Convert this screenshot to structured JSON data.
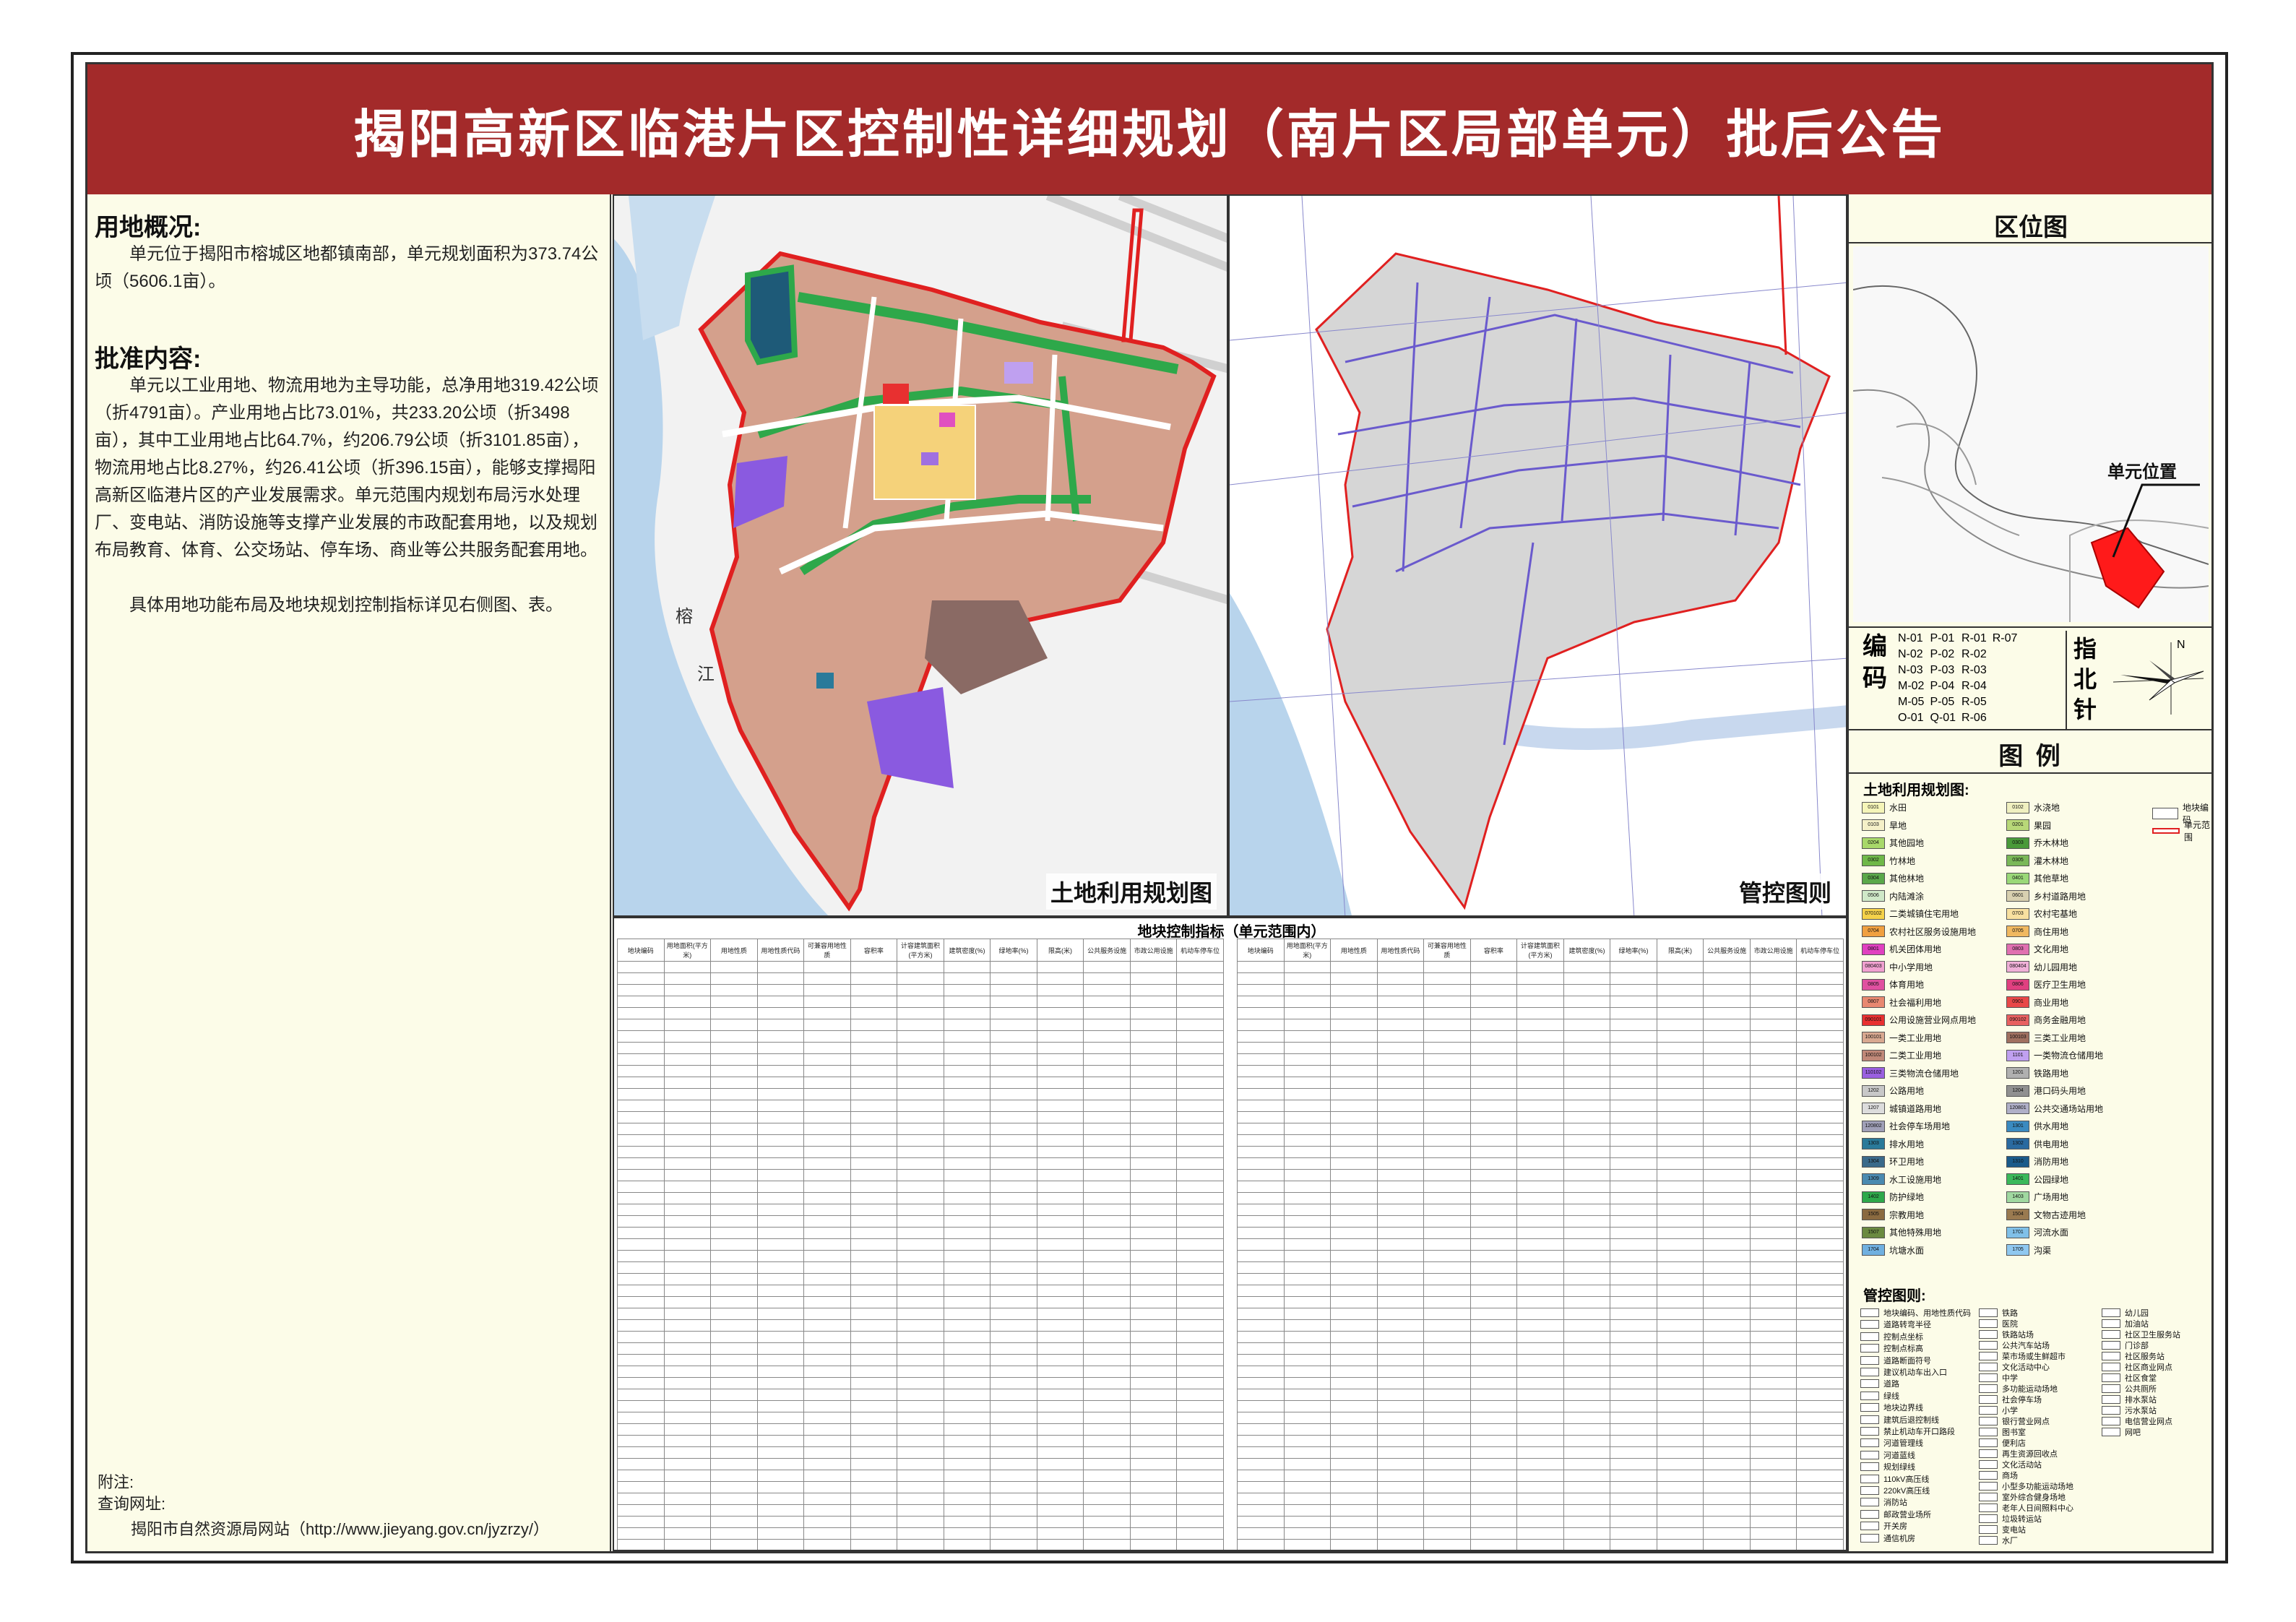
{
  "title": "揭阳高新区临港片区控制性详细规划（南片区局部单元）批后公告",
  "overview": {
    "heading": "用地概况:",
    "text": "单元位于揭阳市榕城区地都镇南部，单元规划面积为373.74公顷（5606.1亩）。"
  },
  "approval": {
    "heading": "批准内容:",
    "text1": "单元以工业用地、物流用地为主导功能，总净用地319.42公顷（折4791亩）。产业用地占比73.01%，共233.20公顷（折3498亩），其中工业用地占比64.7%，约206.79公顷（折3101.85亩），物流用地占比8.27%，约26.41公顷（折396.15亩），能够支撑揭阳高新区临港片区的产业发展需求。单元范围内规划布局污水处理厂、变电站、消防设施等支撑产业发展的市政配套用地，以及规划布局教育、体育、公交场站、停车场、商业等公共服务配套用地。",
    "text2": "具体用地功能布局及地块规划控制指标详见右侧图、表。"
  },
  "footer": {
    "note": "附注:",
    "query": "查询网址:",
    "site": "揭阳市自然资源局网站（http://www.jieyang.gov.cn/jyzrzy/）"
  },
  "map1": {
    "label": "土地利用规划图",
    "river_char1": "榕",
    "river_char2": "江"
  },
  "map2": {
    "label": "管控图则"
  },
  "table": {
    "title": "地块控制指标（单元范围内）",
    "headers": [
      "地块编码",
      "用地面积(平方米)",
      "用地性质",
      "用地性质代码",
      "可兼容用地性质",
      "容积率",
      "计容建筑面积(平方米)",
      "建筑密度(%)",
      "绿地率(%)",
      "限高(米)",
      "公共服务设施",
      "市政公用设施",
      "机动车停车位"
    ]
  },
  "location": {
    "title": "区位图",
    "marker": "单元位置"
  },
  "codes": {
    "label": "编码",
    "col1": [
      "N-01",
      "N-02",
      "N-03",
      "M-02",
      "M-05",
      "O-01"
    ],
    "col2": [
      "P-01",
      "P-02",
      "P-03",
      "P-04",
      "P-05",
      "Q-01"
    ],
    "col3": [
      "R-01",
      "R-02",
      "R-03",
      "R-04",
      "R-05",
      "R-06"
    ],
    "col4": [
      "R-07"
    ],
    "compass_label": "指北针",
    "north": "N"
  },
  "legend": {
    "title": "图    例",
    "land_title": "土地利用规划图:",
    "land_left": [
      {
        "code": "0101",
        "name": "水田",
        "color": "#f5f5b8"
      },
      {
        "code": "0103",
        "name": "旱地",
        "color": "#f5f0c8"
      },
      {
        "code": "0204",
        "name": "其他园地",
        "color": "#a8d86a"
      },
      {
        "code": "0302",
        "name": "竹林地",
        "color": "#6fb848"
      },
      {
        "code": "0304",
        "name": "其他林地",
        "color": "#5aa84a"
      },
      {
        "code": "0506",
        "name": "内陆滩涂",
        "color": "#cfe8c8"
      },
      {
        "code": "070102",
        "name": "二类城镇住宅用地",
        "color": "#f5d24a"
      },
      {
        "code": "0704",
        "name": "农村社区服务设施用地",
        "color": "#f0a040"
      },
      {
        "code": "0801",
        "name": "机关团体用地",
        "color": "#e040c0"
      },
      {
        "code": "080403",
        "name": "中小学用地",
        "color": "#f0a0d0"
      },
      {
        "code": "0805",
        "name": "体育用地",
        "color": "#e050a0"
      },
      {
        "code": "0807",
        "name": "社会福利用地",
        "color": "#e88870"
      },
      {
        "code": "090101",
        "name": "公用设施营业网点用地",
        "color": "#e83030"
      },
      {
        "code": "100101",
        "name": "一类工业用地",
        "color": "#d8a890"
      },
      {
        "code": "100102",
        "name": "二类工业用地",
        "color": "#c08878"
      },
      {
        "code": "110102",
        "name": "三类物流仓储用地",
        "color": "#9a60e0"
      },
      {
        "code": "1202",
        "name": "公路用地",
        "color": "#c8c8c8"
      },
      {
        "code": "1207",
        "name": "城镇道路用地",
        "color": "#dcdcdc"
      },
      {
        "code": "120802",
        "name": "社会停车场用地",
        "color": "#a0a0b8"
      },
      {
        "code": "1303",
        "name": "排水用地",
        "color": "#2a7a9a"
      },
      {
        "code": "1304",
        "name": "环卫用地",
        "color": "#3a6a8a"
      },
      {
        "code": "1309",
        "name": "水工设施用地",
        "color": "#4a8ab0"
      },
      {
        "code": "1402",
        "name": "防护绿地",
        "color": "#2ea84a"
      },
      {
        "code": "1505",
        "name": "宗教用地",
        "color": "#8a6a40"
      },
      {
        "code": "1507",
        "name": "其他特殊用地",
        "color": "#6a8a40"
      },
      {
        "code": "1704",
        "name": "坑塘水面",
        "color": "#70b0e0"
      }
    ],
    "land_right": [
      {
        "code": "0102",
        "name": "水浇地",
        "color": "#f0f0c0"
      },
      {
        "code": "0201",
        "name": "果园",
        "color": "#b8d878"
      },
      {
        "code": "0303",
        "name": "乔木林地",
        "color": "#4a9a3a"
      },
      {
        "code": "0305",
        "name": "灌木林地",
        "color": "#7ab858"
      },
      {
        "code": "0401",
        "name": "其他草地",
        "color": "#9ad878"
      },
      {
        "code": "0601",
        "name": "乡村道路用地",
        "color": "#d8d0b0"
      },
      {
        "code": "0703",
        "name": "农村宅基地",
        "color": "#f8e0a0"
      },
      {
        "code": "0705",
        "name": "商住用地",
        "color": "#f0b860"
      },
      {
        "code": "0803",
        "name": "文化用地",
        "color": "#e070b0"
      },
      {
        "code": "080404",
        "name": "幼儿园用地",
        "color": "#f0b0d8"
      },
      {
        "code": "0806",
        "name": "医疗卫生用地",
        "color": "#e04080"
      },
      {
        "code": "0901",
        "name": "商业用地",
        "color": "#e84848"
      },
      {
        "code": "090102",
        "name": "商务金融用地",
        "color": "#e86060"
      },
      {
        "code": "100103",
        "name": "三类工业用地",
        "color": "#a07060"
      },
      {
        "code": "1101",
        "name": "一类物流仓储用地",
        "color": "#c0a0f0"
      },
      {
        "code": "1201",
        "name": "铁路用地",
        "color": "#b0b0b0"
      },
      {
        "code": "1204",
        "name": "港口码头用地",
        "color": "#909090"
      },
      {
        "code": "120801",
        "name": "公共交通场站用地",
        "color": "#b0b0c8"
      },
      {
        "code": "1301",
        "name": "供水用地",
        "color": "#3a8ac0"
      },
      {
        "code": "1302",
        "name": "供电用地",
        "color": "#2a6aa0"
      },
      {
        "code": "1310",
        "name": "消防用地",
        "color": "#1a5a8a"
      },
      {
        "code": "1401",
        "name": "公园绿地",
        "color": "#3ab85a"
      },
      {
        "code": "1403",
        "name": "广场用地",
        "color": "#a0d8a0"
      },
      {
        "code": "1504",
        "name": "文物古迹用地",
        "color": "#9a7a50"
      },
      {
        "code": "1701",
        "name": "河流水面",
        "color": "#80c0e8"
      },
      {
        "code": "1705",
        "name": "沟渠",
        "color": "#90c8f0"
      }
    ],
    "boundary1": "地块编码",
    "boundary2": "单元范围",
    "control_title": "管控图则:",
    "control_left": [
      "地块编码、用地性质代码",
      "道路转弯半径",
      "控制点坐标",
      "控制点标高",
      "道路断面符号",
      "建议机动车出入口",
      "道路",
      "绿线",
      "地块边界线",
      "建筑后退控制线",
      "禁止机动车开口路段",
      "河道管理线",
      "河道蓝线",
      "规划绿线",
      "110kV高压线",
      "220kV高压线",
      "消防站",
      "邮政营业场所",
      "开关房",
      "通信机房"
    ],
    "control_mid": [
      "铁路",
      "医院",
      "铁路站场",
      "公共汽车站场",
      "菜市场或生鲜超市",
      "文化活动中心",
      "中学",
      "多功能运动场地",
      "社会停车场",
      "小学",
      "银行营业网点",
      "图书室",
      "便利店",
      "再生资源回收点",
      "文化活动站",
      "商场",
      "小型多功能运动场地",
      "室外综合健身场地",
      "老年人日间照料中心",
      "垃圾转运站",
      "变电站",
      "水厂"
    ],
    "control_right": [
      "幼儿园",
      "加油站",
      "社区卫生服务站",
      "门诊部",
      "社区服务站",
      "社区商业网点",
      "社区食堂",
      "公共厕所",
      "排水泵站",
      "污水泵站",
      "电信营业网点",
      "网吧"
    ]
  }
}
